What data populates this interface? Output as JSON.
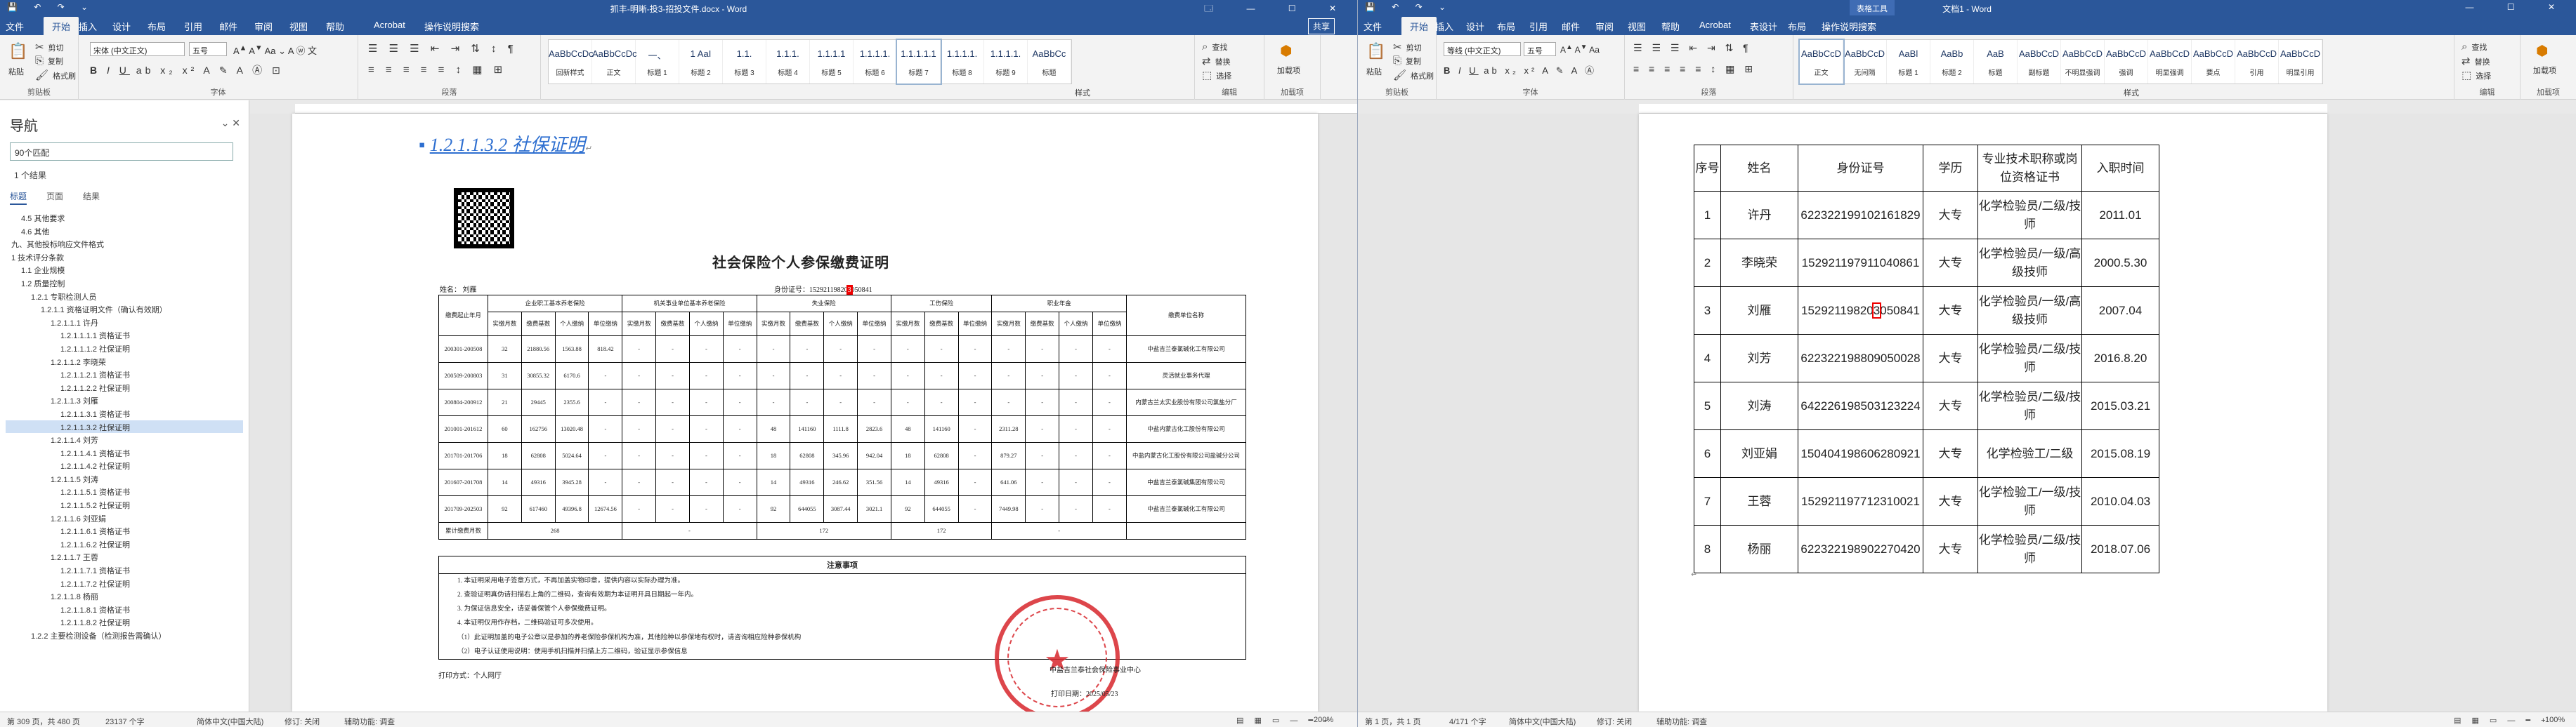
{
  "left_window": {
    "qat": "💾 ↶ ↷ ⌄",
    "title": "抓丰-明晰-投3-招投文件.docx - Word",
    "ctx_tabs": [],
    "window_controls": "🗔 — ☐ ✕",
    "tabs": [
      "文件",
      "开始",
      "插入",
      "设计",
      "布局",
      "引用",
      "邮件",
      "审阅",
      "视图",
      "帮助",
      "Acrobat",
      "操作说明搜索"
    ],
    "share": "共享",
    "ribbon": {
      "clipboard": {
        "paste": "粘贴",
        "cut": "剪切",
        "copy": "复制",
        "format_painter": "格式刷",
        "label": "剪贴板"
      },
      "font": {
        "name": "宋体 (中文正文)",
        "size": "五号",
        "label": "字体"
      },
      "paragraph": {
        "label": "段落"
      },
      "styles": {
        "label": "样式",
        "items": [
          {
            "sample": "AaBbCcDc",
            "name": "回新样式"
          },
          {
            "sample": "AaBbCcDc",
            "name": "正文"
          },
          {
            "sample": "一、",
            "name": "标题 1"
          },
          {
            "sample": "1 AaI",
            "name": "标题 2"
          },
          {
            "sample": "1.1.",
            "name": "标题 3"
          },
          {
            "sample": "1.1.1.",
            "name": "标题 4"
          },
          {
            "sample": "1.1.1.1",
            "name": "标题 5"
          },
          {
            "sample": "1.1.1.1.",
            "name": "标题 6"
          },
          {
            "sample": "1.1.1.1.1",
            "name": "标题 7"
          },
          {
            "sample": "1.1.1.1.",
            "name": "标题 8"
          },
          {
            "sample": "1.1.1.1.",
            "name": "标题 9"
          },
          {
            "sample": "AaBbCc",
            "name": "标题"
          }
        ]
      },
      "editing": {
        "find": "查找",
        "replace": "替换",
        "select": "选择",
        "label": "编辑"
      },
      "addin": {
        "name": "加载项",
        "label": "加载项"
      }
    },
    "nav": {
      "title": "导航",
      "search_value": "90个匹配",
      "results": "1 个结果",
      "tabs": [
        "标题",
        "页面",
        "结果"
      ],
      "tree": [
        "4.5 其他要求",
        "4.6 其他",
        "九、其他投标响应文件格式",
        "1 技术评分条款",
        "1.1 企业规模",
        "1.2 质量控制",
        "1.2.1 专职检测人员",
        "1.2.1.1 资格证明文件（确认有效期）",
        "1.2.1.1.1 许丹",
        "1.2.1.1.1.1 资格证书",
        "1.2.1.1.1.2 社保证明",
        "1.2.1.1.2 李晓荣",
        "1.2.1.1.2.1 资格证书",
        "1.2.1.1.2.2 社保证明",
        "1.2.1.1.3 刘雁",
        "1.2.1.1.3.1 资格证书",
        "1.2.1.1.3.2 社保证明",
        "1.2.1.1.4 刘芳",
        "1.2.1.1.4.1 资格证书",
        "1.2.1.1.4.2 社保证明",
        "1.2.1.1.5 刘涛",
        "1.2.1.1.5.1 资格证书",
        "1.2.1.1.5.2 社保证明",
        "1.2.1.1.6 刘亚娟",
        "1.2.1.1.6.1 资格证书",
        "1.2.1.1.6.2 社保证明",
        "1.2.1.1.7 王蓉",
        "1.2.1.1.7.1 资格证书",
        "1.2.1.1.7.2 社保证明",
        "1.2.1.1.8 杨丽",
        "1.2.1.1.8.1 资格证书",
        "1.2.1.1.8.2 社保证明",
        "1.2.2 主要检测设备（检测报告需确认）"
      ],
      "selected_index": 16
    },
    "doc": {
      "heading": "1.2.1.1.3.2 社保证明",
      "cert_title": "社会保险个人参保缴费证明",
      "name_label": "姓名：",
      "name_value": "刘雁",
      "id_label": "身份证号：",
      "id_value": "15292119820",
      "id_highlight": "3",
      "id_suffix": "050841",
      "groups": [
        "企业职工基本养老保险",
        "机关事业单位基本养老保险",
        "失业保险",
        "工伤保险",
        "职业年金"
      ],
      "col_period": "缴费起止年月",
      "col_unit": "缴费单位名称",
      "sub_a": [
        "实缴月数",
        "缴费基数",
        "个人缴纳",
        "单位缴纳"
      ],
      "sub_b": [
        "实缴月数",
        "缴费基数",
        "个人缴纳",
        "单位缴纳"
      ],
      "sub_c": [
        "实缴月数",
        "缴费基数",
        "个人缴纳",
        "单位缴纳"
      ],
      "sub_d": [
        "实缴月数",
        "缴费基数",
        "单位缴纳"
      ],
      "sub_e": [
        "实缴月数",
        "缴费基数",
        "个人缴纳",
        "单位缴纳"
      ],
      "rows": [
        [
          "200301-200508",
          "32",
          "21880.56",
          "1563.88",
          "818.42",
          "-",
          "-",
          "-",
          "-",
          "-",
          "-",
          "-",
          "-",
          "-",
          "-",
          "-",
          "-",
          "-",
          "-",
          "-",
          "中盐吉兰泰氯碱化工有限公司"
        ],
        [
          "200509-200803",
          "31",
          "30855.32",
          "6170.6",
          "-",
          "-",
          "-",
          "-",
          "-",
          "-",
          "-",
          "-",
          "-",
          "-",
          "-",
          "-",
          "-",
          "-",
          "-",
          "-",
          "灵活就业事务代理"
        ],
        [
          "200804-200912",
          "21",
          "29445",
          "2355.6",
          "-",
          "-",
          "-",
          "-",
          "-",
          "-",
          "-",
          "-",
          "-",
          "-",
          "-",
          "-",
          "-",
          "-",
          "-",
          "-",
          "内蒙古兰太实业股份有限公司氯盐分厂"
        ],
        [
          "201001-201612",
          "60",
          "162756",
          "13020.48",
          "-",
          "-",
          "-",
          "-",
          "-",
          "48",
          "141160",
          "1111.8",
          "2823.6",
          "48",
          "141160",
          "-",
          "2311.28",
          "-",
          "-",
          "-",
          "中盐内蒙古化工股份有限公司"
        ],
        [
          "201701-201706",
          "18",
          "62808",
          "5024.64",
          "-",
          "-",
          "-",
          "-",
          "-",
          "18",
          "62808",
          "345.96",
          "942.04",
          "18",
          "62808",
          "-",
          "879.27",
          "-",
          "-",
          "-",
          "中盐内蒙古化工股份有限公司盐碱分公司"
        ],
        [
          "201607-201708",
          "14",
          "49316",
          "3945.28",
          "-",
          "-",
          "-",
          "-",
          "-",
          "14",
          "49316",
          "246.62",
          "351.56",
          "14",
          "49316",
          "-",
          "641.06",
          "-",
          "-",
          "-",
          "中盐吉兰泰氯碱集团有限公司"
        ],
        [
          "201709-202503",
          "92",
          "617460",
          "49396.8",
          "12674.56",
          "-",
          "-",
          "-",
          "-",
          "92",
          "644055",
          "3087.44",
          "3021.1",
          "92",
          "644055",
          "-",
          "7449.98",
          "-",
          "-",
          "-",
          "中盐吉兰泰氯碱化工有限公司"
        ]
      ],
      "total_label": "累计缴费月数",
      "totals": [
        "268",
        "-",
        "172",
        "172",
        "-"
      ],
      "notes_title": "注意事项",
      "notes": [
        "1. 本证明采用电子签章方式，不再加盖实物印章，提供内容以实际办理为准。",
        "2. 查验证明真伪请扫描右上角的二维码，查询有效期为本证明开具日期起一年内。",
        "3. 为保证信息安全，请妥善保管个人参保缴费证明。",
        "4. 本证明仅用作存档，二维码验证可多次使用。",
        "（1）此证明加盖的电子公章以是参加的养老保险参保机构为准，其他险种以参保地有权时，请咨询相应险种参保机构",
        "（2）电子认证使用说明：使用手机扫描并扫描上方二维码，验证显示参保信息"
      ],
      "print_label": "打印方式：个人网厅",
      "stamp_caption": "中盐吉兰泰社会保险事业中心",
      "print_date": "打印日期：2025/05/23"
    },
    "status": {
      "page": "第 309 页，共 480 页",
      "words": "23137 个字",
      "lang": "简体中文(中国大陆)",
      "track": "修订: 关闭",
      "access": "辅助功能: 调查",
      "zoom": "200%"
    }
  },
  "right_window": {
    "qat": "💾 ↶ ↷ ⌄",
    "title": "文档1 - Word",
    "ctx_tabs": [
      "表格工具"
    ],
    "window_controls": "— ☐ ✕",
    "tabs": [
      "文件",
      "开始",
      "插入",
      "设计",
      "布局",
      "引用",
      "邮件",
      "审阅",
      "视图",
      "帮助",
      "Acrobat",
      "表设计",
      "布局",
      "操作说明搜索"
    ],
    "ribbon": {
      "clipboard": {
        "paste": "粘贴",
        "cut": "剪切",
        "copy": "复制",
        "format_painter": "格式刷",
        "label": "剪贴板"
      },
      "font": {
        "name": "等线 (中文正文)",
        "size": "五号",
        "label": "字体"
      },
      "paragraph": {
        "label": "段落"
      },
      "styles": {
        "label": "样式",
        "items": [
          {
            "sample": "AaBbCcD",
            "name": "正文"
          },
          {
            "sample": "AaBbCcD",
            "name": "无间隔"
          },
          {
            "sample": "AaBl",
            "name": "标题 1"
          },
          {
            "sample": "AaBb",
            "name": "标题 2"
          },
          {
            "sample": "AaB",
            "name": "标题"
          },
          {
            "sample": "AaBbCcD",
            "name": "副标题"
          },
          {
            "sample": "AaBbCcD",
            "name": "不明显强调"
          },
          {
            "sample": "AaBbCcD",
            "name": "强调"
          },
          {
            "sample": "AaBbCcD",
            "name": "明显强调"
          },
          {
            "sample": "AaBbCcD",
            "name": "要点"
          },
          {
            "sample": "AaBbCcD",
            "name": "引用"
          },
          {
            "sample": "AaBbCcD",
            "name": "明显引用"
          }
        ]
      },
      "editing": {
        "find": "查找",
        "replace": "替换",
        "select": "选择",
        "label": "编辑"
      },
      "addin": {
        "name": "加载项",
        "label": "加载项"
      }
    },
    "table": {
      "headers": [
        "序号",
        "姓名",
        "身份证号",
        "学历",
        "专业技术职称或岗位资格证书",
        "入职时间"
      ],
      "rows": [
        [
          "1",
          "许丹",
          "622322199102161829",
          "大专",
          "化学检验员/二级/技师",
          "2011.01"
        ],
        [
          "2",
          "李晓荣",
          "152921197911040861",
          "大专",
          "化学检验员/一级/高级技师",
          "2000.5.30"
        ],
        [
          "3",
          "刘雁",
          "152921198203050841",
          "大专",
          "化学检验员/一级/高级技师",
          "2007.04"
        ],
        [
          "4",
          "刘芳",
          "622322198809050028",
          "大专",
          "化学检验员/二级/技师",
          "2016.8.20"
        ],
        [
          "5",
          "刘涛",
          "642226198503123224",
          "大专",
          "化学检验员/二级/技师",
          "2015.03.21"
        ],
        [
          "6",
          "刘亚娟",
          "150404198606280921",
          "大专",
          "化学检验工/二级",
          "2015.08.19"
        ],
        [
          "7",
          "王蓉",
          "152921197712310021",
          "大专",
          "化学检验工/一级/技师",
          "2010.04.03"
        ],
        [
          "8",
          "杨丽",
          "622322198902270420",
          "大专",
          "化学检验员/二级/技师",
          "2018.07.06"
        ]
      ],
      "highlight_row": 2,
      "highlight_char_index": 11
    },
    "status": {
      "page": "第 1 页，共 1 页",
      "words": "4/171 个字",
      "lang": "简体中文(中国大陆)",
      "track": "修订: 关闭",
      "access": "辅助功能: 调查",
      "zoom": "100%"
    }
  }
}
